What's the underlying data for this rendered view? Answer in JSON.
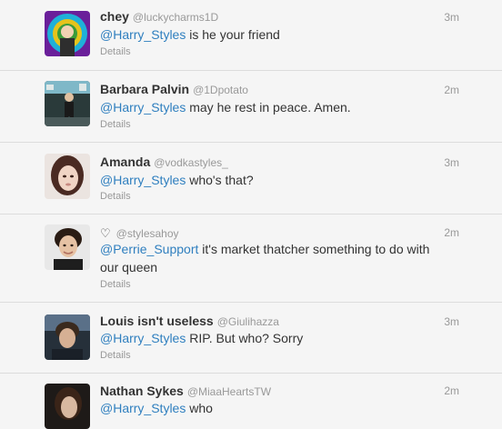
{
  "tweets": [
    {
      "name": "chey",
      "handle": "@luckycharms1D",
      "time": "3m",
      "mention": "@Harry_Styles",
      "text": " is he your friend",
      "details": "Details",
      "avatar": "avatar-swirl",
      "avatar_colors": [
        "#7a2aa8",
        "#2fb8e0",
        "#e4c21a"
      ]
    },
    {
      "name": "Barbara Palvin",
      "handle": "@1Dpotato",
      "time": "2m",
      "mention": "@Harry_Styles",
      "text": " may he rest in peace. Amen.",
      "details": "Details",
      "avatar": "avatar-performer"
    },
    {
      "name": "Amanda",
      "handle": "@vodkastyles_",
      "time": "3m",
      "mention": "@Harry_Styles",
      "text": " who's that?",
      "details": "Details",
      "avatar": "avatar-girl"
    },
    {
      "name": "",
      "heart": "♡",
      "handle": "@stylesahoy",
      "time": "2m",
      "mention": "@Perrie_Support",
      "text": " it's market thatcher something to do with",
      "text2": "our queen",
      "details": "Details",
      "avatar": "avatar-boy"
    },
    {
      "name": "Louis isn't useless",
      "handle": "@Giulihazza",
      "time": "3m",
      "mention": "@Harry_Styles",
      "text": " RIP. But who? Sorry",
      "details": "Details",
      "avatar": "avatar-louis"
    },
    {
      "name": "Nathan Sykes",
      "handle": "@MiaaHeartsTW",
      "time": "2m",
      "mention": "@Harry_Styles",
      "text": " who",
      "details": "",
      "avatar": "avatar-dark"
    }
  ]
}
